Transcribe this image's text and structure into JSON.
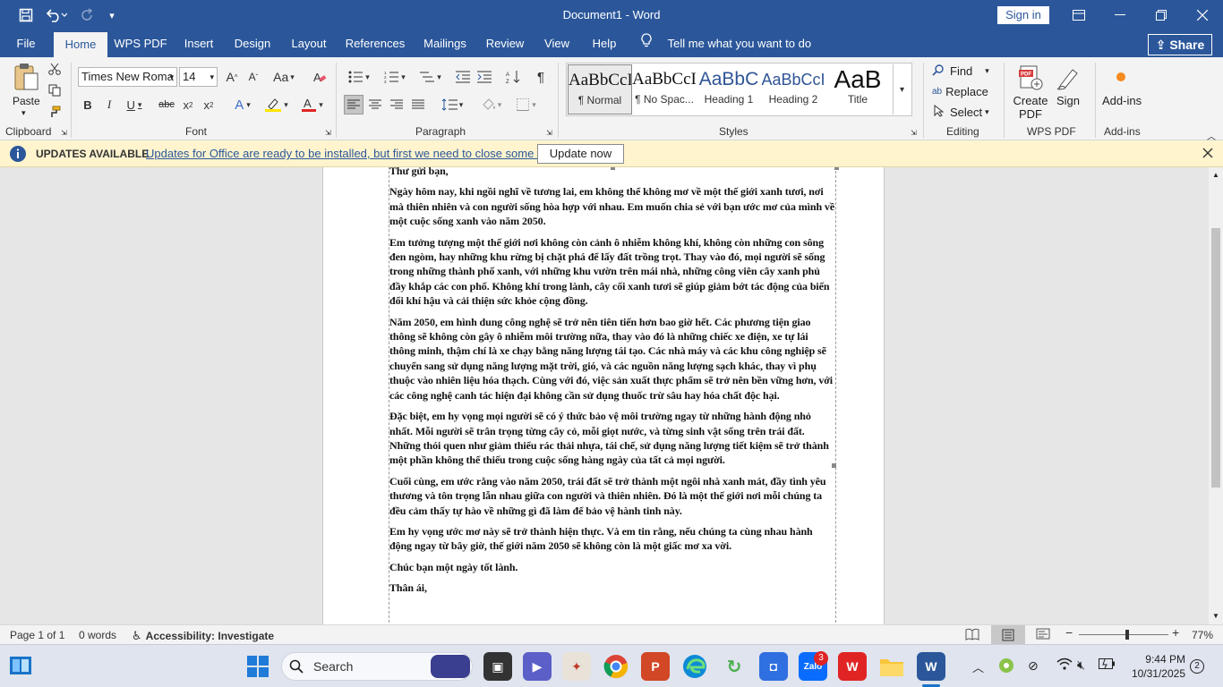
{
  "window": {
    "title": "Document1 - Word",
    "signin_label": "Sign in"
  },
  "tabs": [
    {
      "label": "File"
    },
    {
      "label": "Home"
    },
    {
      "label": "WPS PDF"
    },
    {
      "label": "Insert"
    },
    {
      "label": "Design"
    },
    {
      "label": "Layout"
    },
    {
      "label": "References"
    },
    {
      "label": "Mailings"
    },
    {
      "label": "Review"
    },
    {
      "label": "View"
    },
    {
      "label": "Help"
    }
  ],
  "tellme": "Tell me what you want to do",
  "share_label": "Share",
  "ribbon": {
    "clipboard": {
      "group": "Clipboard",
      "paste": "Paste"
    },
    "font": {
      "group": "Font",
      "family": "Times New Roma",
      "size": "14",
      "aa_label": "Aa"
    },
    "paragraph": {
      "group": "Paragraph"
    },
    "styles": {
      "group": "Styles",
      "items": [
        {
          "preview": "AaBbCcI",
          "name": "¶ Normal"
        },
        {
          "preview": "AaBbCcI",
          "name": "¶ No Spac..."
        },
        {
          "preview": "AaBbC",
          "name": "Heading 1"
        },
        {
          "preview": "AaBbCcI",
          "name": "Heading 2"
        },
        {
          "preview": "AaB",
          "name": "Title"
        }
      ]
    },
    "editing": {
      "group": "Editing",
      "find": "Find",
      "replace": "Replace",
      "select": "Select"
    },
    "wps": {
      "group": "WPS PDF",
      "create": "Create PDF",
      "sign": "Sign"
    },
    "addins": {
      "group": "Add-ins",
      "label": "Add-ins"
    }
  },
  "updates": {
    "title": "UPDATES AVAILABLE",
    "message": "Updates for Office are ready to be installed, but first we need to close some apps.",
    "button": "Update now"
  },
  "document": {
    "paragraphs": [
      "Thư gửi bạn,",
      "Ngày hôm nay, khi ngồi nghĩ về tương lai, em không thể không mơ về một thế giới xanh tươi, nơi mà thiên nhiên và con người sống hòa hợp với nhau. Em muốn chia sẻ với bạn ước mơ của mình về một cuộc sống xanh vào năm 2050.",
      "Em tưởng tượng một thế giới nơi không còn cảnh ô nhiễm không khí, không còn những con sông đen ngòm, hay những khu rừng bị chặt phá để lấy đất trồng trọt. Thay vào đó, mọi người sẽ sống trong những thành phố xanh, với những khu vườn trên mái nhà, những công viên cây xanh phủ đầy khắp các con phố. Không khí trong lành, cây cối xanh tươi sẽ giúp giảm bớt tác động của biến đổi khí hậu và cải thiện sức khỏe cộng đồng.",
      "Năm 2050, em hình dung công nghệ sẽ trở nên tiên tiến hơn bao giờ hết. Các phương tiện giao thông sẽ không còn gây ô nhiễm môi trường nữa, thay vào đó là những chiếc xe điện, xe tự lái thông minh, thậm chí là xe chạy bằng năng lượng tái tạo. Các nhà máy và các khu công nghiệp sẽ chuyển sang sử dụng năng lượng mặt trời, gió, và các nguồn năng lượng sạch khác, thay vì phụ thuộc vào nhiên liệu hóa thạch. Cùng với đó, việc sản xuất thực phẩm sẽ trở nên bền vững hơn, với các công nghệ canh tác hiện đại không cần sử dụng thuốc trừ sâu hay hóa chất độc hại.",
      "Đặc biệt, em hy vọng mọi người sẽ có ý thức bảo vệ môi trường ngay từ những hành động nhỏ nhất. Mỗi người sẽ trân trọng từng cây cỏ, mỗi giọt nước, và từng sinh vật sống trên trái đất. Những thói quen như giảm thiểu rác thải nhựa, tái chế, sử dụng năng lượng tiết kiệm sẽ trở thành một phần không thể thiếu trong cuộc sống hàng ngày của tất cả mọi người.",
      "Cuối cùng, em ước rằng vào năm 2050, trái đất sẽ trở thành một ngôi nhà xanh mát, đầy tình yêu thương và tôn trọng lẫn nhau giữa con người và thiên nhiên. Đó là một thế giới nơi mỗi chúng ta đều cảm thấy tự hào về những gì đã làm để bảo vệ hành tinh này.",
      "Em hy vọng ước mơ này sẽ trở thành hiện thực. Và em tin rằng, nếu chúng ta cùng nhau hành động ngay từ bây giờ, thế giới năm 2050 sẽ không còn là một giấc mơ xa vời.",
      "Chúc bạn một ngày tốt lành.",
      "Thân ái,"
    ]
  },
  "status": {
    "page": "Page 1 of 1",
    "words": "0 words",
    "accessibility": "Accessibility: Investigate",
    "zoom": "77%",
    "zoom_fraction": 0.54
  },
  "taskbar": {
    "search": "Search",
    "zalo_badge": "3",
    "time": "9:44 PM",
    "date": "10/31/2025",
    "notif_count": "2"
  },
  "colors": {
    "brand": "#2b579a",
    "ribbon_bg": "#f3f3f3",
    "update_bar": "#fff4ce"
  }
}
